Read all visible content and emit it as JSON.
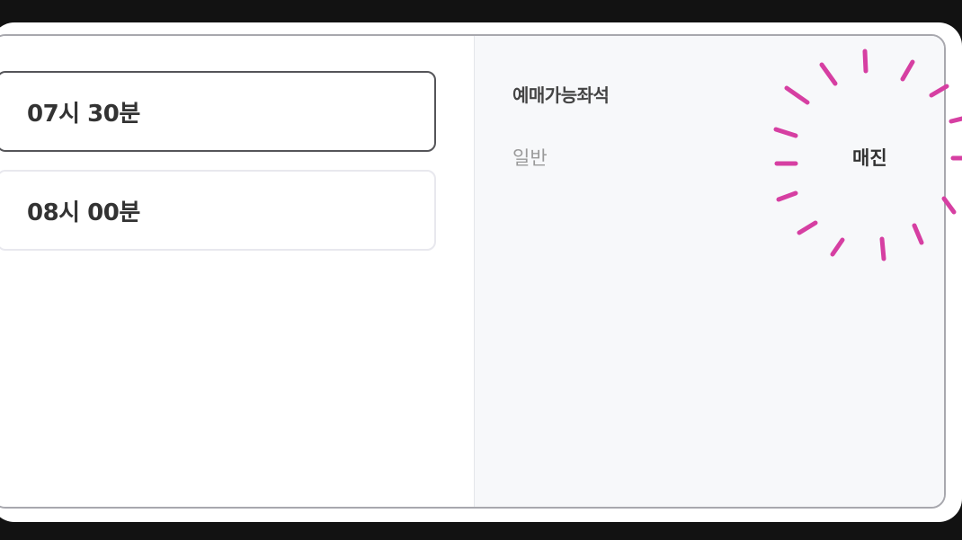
{
  "times": [
    {
      "label": "07시 30분",
      "selected": true
    },
    {
      "label": "08시 00분",
      "selected": false
    }
  ],
  "seats": {
    "title": "예매가능좌석",
    "rows": [
      {
        "type": "일반",
        "status": "매진"
      }
    ]
  },
  "colors": {
    "highlight_marks": "#d63fa2",
    "selected_border": "#555559",
    "right_panel_bg": "#f7f8fa"
  }
}
